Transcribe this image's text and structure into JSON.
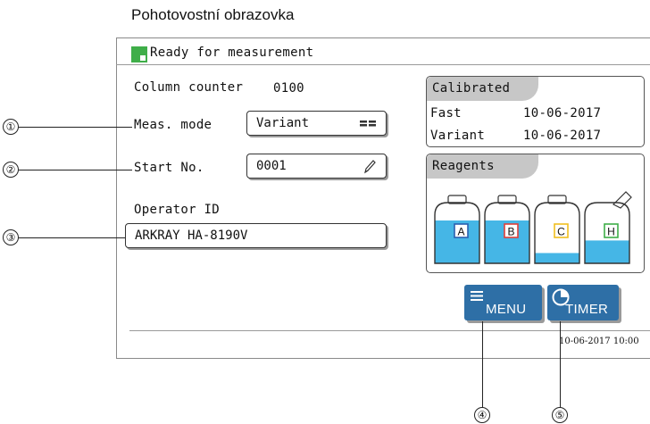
{
  "caption": "Pohotovostní obrazovka",
  "status": {
    "text": "Ready for measurement",
    "color": "#3fae49"
  },
  "column_counter": {
    "label": "Column counter",
    "value": "0100"
  },
  "meas_mode": {
    "label": "Meas. mode",
    "value": "Variant",
    "icon": "list-grid-icon"
  },
  "start_no": {
    "label": "Start No.",
    "value": "0001",
    "icon": "pencil-icon"
  },
  "operator_id": {
    "label": "Operator ID",
    "value": "ARKRAY HA-8190V"
  },
  "calibrated": {
    "title": "Calibrated",
    "rows": [
      {
        "mode": "Fast",
        "date": "10-06-2017"
      },
      {
        "mode": "Variant",
        "date": "10-06-2017"
      }
    ]
  },
  "reagents": {
    "title": "Reagents",
    "bottles": [
      {
        "letter": "A",
        "level": 0.75,
        "color": "#2a5fb0"
      },
      {
        "letter": "B",
        "level": 0.75,
        "color": "#e0403a"
      },
      {
        "letter": "C",
        "level": 0.18,
        "color": "#f0c020"
      },
      {
        "letter": "H",
        "level": 0.4,
        "color": "#3fae49"
      }
    ],
    "liquid_color": "#45b6e6"
  },
  "buttons": {
    "menu": "MENU",
    "timer": "TIMER",
    "color": "#2e6fa6"
  },
  "timestamp": "10-06-2017 10:00",
  "callouts": [
    "①",
    "②",
    "③",
    "④",
    "⑤"
  ]
}
